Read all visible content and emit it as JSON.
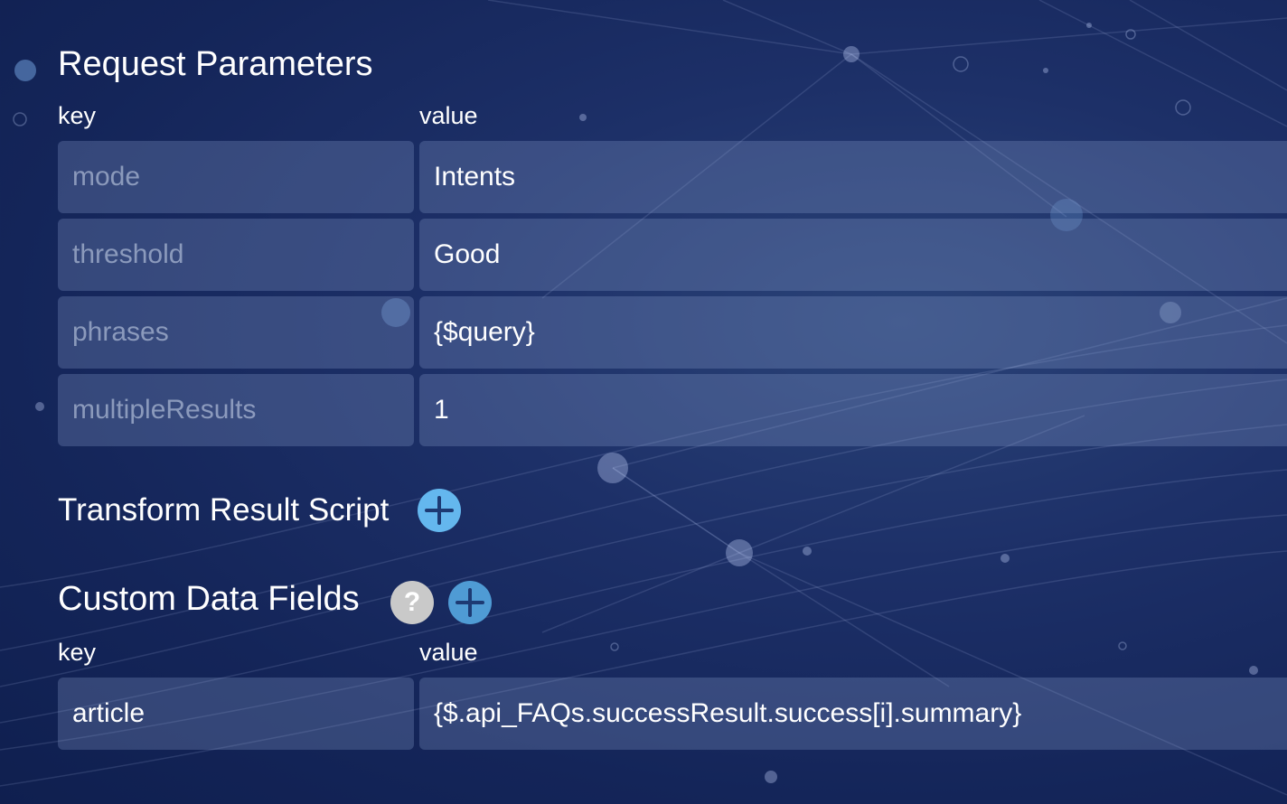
{
  "request_parameters": {
    "title": "Request Parameters",
    "key_header": "key",
    "value_header": "value",
    "rows": [
      {
        "key": "mode",
        "value": "Intents"
      },
      {
        "key": "threshold",
        "value": "Good"
      },
      {
        "key": "phrases",
        "value": "{$query}"
      },
      {
        "key": "multipleResults",
        "value": "1"
      }
    ]
  },
  "transform_result_script": {
    "title": "Transform Result Script",
    "add_icon": "plus-icon"
  },
  "custom_data_fields": {
    "title": "Custom Data Fields",
    "help_icon": "question-icon",
    "help_text": "?",
    "add_icon": "plus-icon",
    "key_header": "key",
    "value_header": "value",
    "rows": [
      {
        "key": "article",
        "value": "{$.api_FAQs.successResult.success[i].summary}"
      }
    ]
  },
  "colors": {
    "background": "#1a2c63",
    "field_background": "rgba(140,160,210,0.28)",
    "add_button": "#64b7ee",
    "help_button": "#c9c9c9"
  }
}
